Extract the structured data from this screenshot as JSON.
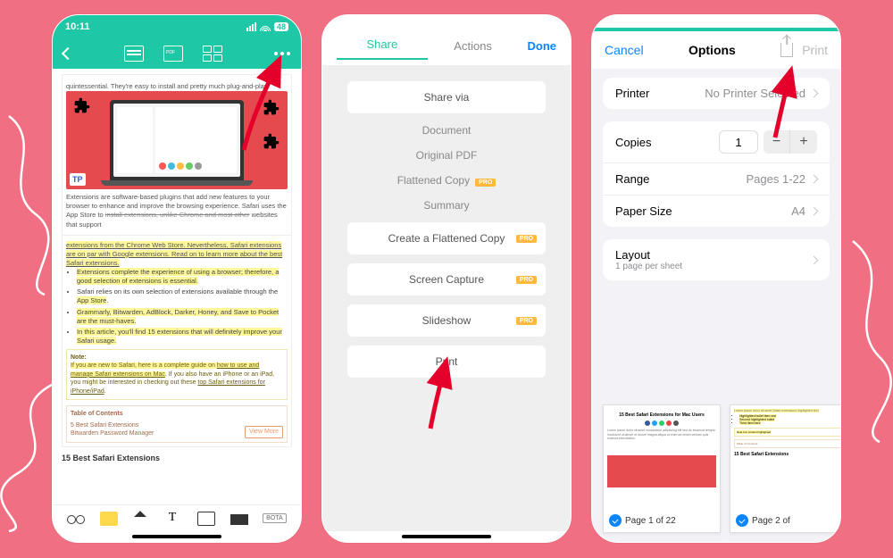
{
  "phone1": {
    "status_time": "10:11",
    "battery_badge": "48",
    "intro_line": "quintessential. They're easy to install and pretty much plug-and-play.",
    "tp_badge": "TP",
    "para1a": "Extensions are software-based plugins that add new features to your browser to enhance and improve the browsing experience. Safari uses the App Store to ",
    "para1b": "install extensions, unlike Chrome and most other",
    "para1c": " websites that support",
    "para2": "extensions from the Chrome Web Store. Nevertheless, Safari extensions are on par with Google extensions. Read on to learn more about the best Safari extensions.",
    "b1": "Extensions complete the experience of using a browser; therefore, a good selection of extensions is essential.",
    "b2a": "Safari relies on its own selection of extensions available through the ",
    "b2b": "App Store",
    "b3": "Grammarly, Bitwarden, AdBlock, Darker, Honey, and Save to Pocket are the must-haves.",
    "b4": "In this article, you'll find 15 extensions that will definitely improve your Safari usage.",
    "note_title": "Note:",
    "note_a": "If you are new to Safari, here is a complete guide on ",
    "note_b": "how to use and manage Safari extensions on Mac",
    "note_c": ". If you also have an iPhone or an iPad, you might be interested in checking out these ",
    "note_d": "top Safari extensions for iPhone/iPad",
    "toc_title": "Table of Contents",
    "toc1": "5 Best Safari Extensions",
    "toc2": "Bitwarden Password Manager",
    "view_more": "View More",
    "h2": "15 Best Safari Extensions",
    "bota": "BOTA"
  },
  "phone2": {
    "tab_share": "Share",
    "tab_actions": "Actions",
    "done": "Done",
    "share_via": "Share via",
    "document": "Document",
    "original_pdf": "Original PDF",
    "flattened_copy": "Flattened Copy",
    "summary": "Summary",
    "create_flattened": "Create a Flattened Copy",
    "screen_capture": "Screen Capture",
    "slideshow": "Slideshow",
    "print": "Print",
    "pro": "PRO"
  },
  "phone3": {
    "cancel": "Cancel",
    "title": "Options",
    "print": "Print",
    "printer_label": "Printer",
    "printer_value": "No Printer Selected",
    "copies_label": "Copies",
    "copies_value": "1",
    "range_label": "Range",
    "range_value": "Pages 1-22",
    "paper_label": "Paper Size",
    "paper_value": "A4",
    "layout_label": "Layout",
    "layout_sub": "1 page per sheet",
    "preview1_label": "Page 1 of 22",
    "preview2_label": "Page 2 of",
    "pv_title": "15 Best Safari Extensions for Mac Users"
  }
}
